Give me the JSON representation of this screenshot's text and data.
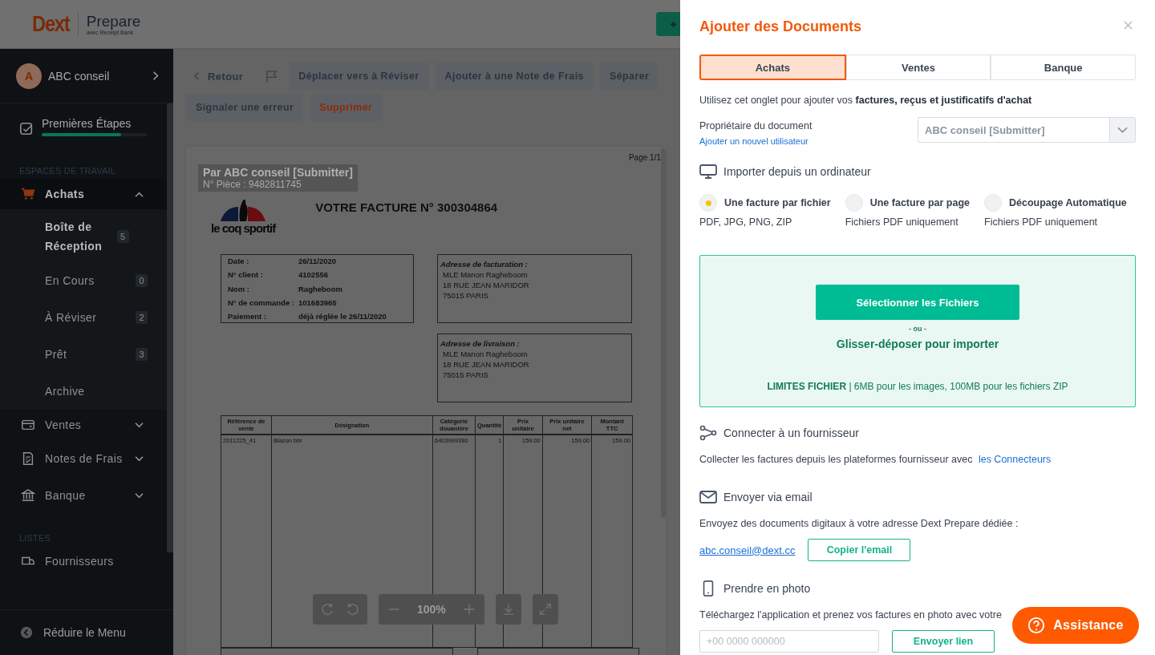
{
  "header": {
    "logo": "Dext",
    "product": "Prepare",
    "tagline": "avec Receipt Bank"
  },
  "sidebar": {
    "account": {
      "initial": "A",
      "name": "ABC conseil"
    },
    "onboarding": {
      "label": "Premières Étapes",
      "level": 0.75
    },
    "sections": [
      {
        "heading": "ESPACES DE TRAVAIL",
        "items": [
          {
            "label": "Achats",
            "expanded": true,
            "children": [
              {
                "label": "Boîte de Réception",
                "count": "5",
                "selected": true
              },
              {
                "label": "En Cours",
                "count": "0",
                "selected": false
              },
              {
                "label": "À Réviser",
                "count": "2",
                "selected": false
              },
              {
                "label": "Prêt",
                "count": "3",
                "selected": false
              },
              {
                "label": "Archive",
                "selected": false
              }
            ]
          },
          {
            "label": "Ventes",
            "expanded": false
          },
          {
            "label": "Notes de Frais",
            "expanded": false
          },
          {
            "label": "Banque",
            "expanded": false
          }
        ]
      },
      {
        "heading": "LISTES",
        "items": [
          {
            "label": "Fournisseurs"
          }
        ]
      }
    ],
    "collapse": "Réduire le Menu"
  },
  "toolbar": {
    "back": "Retour",
    "actions": [
      {
        "label": "Déplacer vers à Réviser",
        "kind": "default"
      },
      {
        "label": "Ajouter à une Note de Frais",
        "kind": "default"
      },
      {
        "label": "Séparer",
        "kind": "default"
      },
      {
        "label": "Signaler une erreur",
        "kind": "default"
      },
      {
        "label": "Supprimer",
        "kind": "danger"
      }
    ]
  },
  "document": {
    "page_label": "Page 1/1",
    "stamp": {
      "submitter": "Par ABC conseil [Submitter]",
      "piece": "N° Pièce : 9482811745"
    },
    "logo": "le coq sportif",
    "title": "VOTRE FACTURE N° 300304864",
    "info": [
      {
        "label": "Date :",
        "value": "26/11/2020"
      },
      {
        "label": "N° client :",
        "value": "4102556"
      },
      {
        "label": "Nom :",
        "value": "Ragheboom"
      },
      {
        "label": "N° de commande :",
        "value": "101683965"
      },
      {
        "label": "Paiement :",
        "value": "déjà réglée le 26/11/2020"
      }
    ],
    "billing": {
      "title": "Adresse de facturation :",
      "lines": [
        "MLE Manon Ragheboom",
        "18 RUE JEAN MARIDOR",
        "75015  PARIS"
      ]
    },
    "delivery": {
      "title": "Adresse de livraison :",
      "lines": [
        "MLE Manon Ragheboom",
        "18 RUE JEAN MARIDOR",
        "75015  PARIS"
      ]
    },
    "table": {
      "columns": [
        "Référence de vente",
        "Désignation",
        "Catégorie douanière",
        "Quantité",
        "Prix unitaire",
        "Prix unitaire net",
        "Montant TTC"
      ],
      "rows": [
        [
          "2011225_41",
          "Blazon bbr",
          "6403999390",
          "1",
          "159.00",
          "159.00",
          "159.00"
        ]
      ]
    }
  },
  "viewer": {
    "zoom": "100%"
  },
  "panel": {
    "title": "Ajouter des Documents",
    "tabs": [
      {
        "label": "Achats",
        "selected": true
      },
      {
        "label": "Ventes",
        "selected": false
      },
      {
        "label": "Banque",
        "selected": false
      }
    ],
    "intro": "Utilisez cet onglet pour ajouter vos **factures, reçus et justificatifs d'achat**",
    "owner": {
      "label": "Propriétaire du document",
      "link": "Ajouter un nouvel utilisateur",
      "value": "ABC conseil [Submitter]"
    },
    "import": {
      "heading": "Importer depuis un ordinateur",
      "options": [
        {
          "label": "Une facture par fichier",
          "hint": "PDF, JPG, PNG, ZIP",
          "selected": true
        },
        {
          "label": "Une facture par page",
          "hint": "Fichiers PDF uniquement",
          "selected": false
        },
        {
          "label": "Découpage Automatique",
          "hint": "Fichiers PDF uniquement",
          "selected": false
        }
      ],
      "dropzone": {
        "button": "Sélectionner les Fichiers",
        "separator": "- ou -",
        "drag": "Glisser-déposer pour importer",
        "limits": "**LIMITES FICHIER** | 6MB pour les images, 100MB pour les fichiers ZIP"
      }
    },
    "connect": {
      "heading": "Connecter à un fournisseur",
      "text": "Collecter les factures depuis les plateformes fournisseur avec",
      "link": "les Connecteurs"
    },
    "email": {
      "heading": "Envoyer via email",
      "text": "Envoyez des documents digitaux à votre adresse Dext Prepare dédiée :",
      "address": "abc.conseil@dext.cc",
      "button": "Copier l'email"
    },
    "photo": {
      "heading": "Prendre en photo",
      "text": "Téléchargez l'application et prenez vos factures en photo avec votre",
      "phone_placeholder": "+00 0000 000000",
      "button": "Envoyer lien"
    }
  },
  "assistance": "Assistance"
}
